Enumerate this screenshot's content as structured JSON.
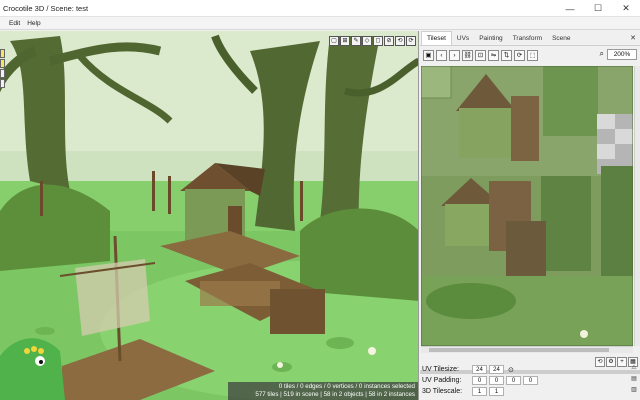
{
  "window": {
    "title": "Crocotile 3D / Scene: test"
  },
  "menu": [
    "Edit",
    "Help"
  ],
  "viewport": {
    "toolbar_glyphs": [
      "▢",
      "⊞",
      "✎",
      "◇",
      "◻",
      "⊘",
      "⟲",
      "⟳"
    ],
    "status_line1": "0 tiles / 0 edges / 0 vertices / 0 instances selected",
    "status_line2": "577 tiles | 519 in scene | 58 in 2 objects | 58 in 2 instances"
  },
  "panel": {
    "tabs": [
      "Tileset",
      "UVs",
      "Painting",
      "Transform",
      "Scene"
    ],
    "active_tab": "Tileset",
    "zoom": "200%",
    "uv_tilesize_label": "UV Tilesize:",
    "uv_tilesize": [
      "24",
      "24"
    ],
    "uv_padding_label": "UV Padding:",
    "uv_padding": [
      "0",
      "0",
      "0",
      "0"
    ],
    "tilescale_label": "3D Tilescale:",
    "tilescale": [
      "1",
      "1"
    ]
  },
  "colors": {
    "accent": "#f6e36a",
    "swamp_bg": "#c8ddb8",
    "moss": "#5f9a3f",
    "water": "#8fd47d",
    "wood": "#7a5b3a"
  }
}
